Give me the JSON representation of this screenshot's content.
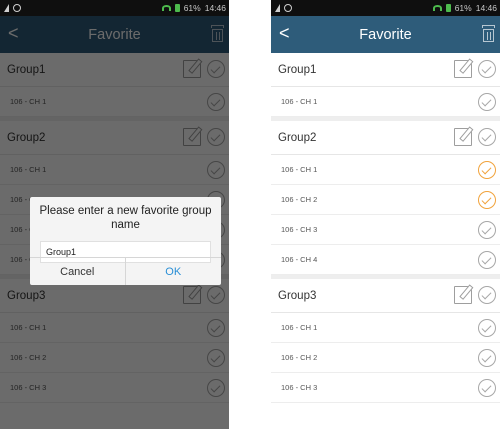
{
  "status_bar": {
    "battery": "61%",
    "time": "14:46"
  },
  "title_bar": {
    "back_label": "<",
    "title": "Favorite"
  },
  "groups": [
    {
      "name": "Group1",
      "channels": [
        "106 - CH 1"
      ]
    },
    {
      "name": "Group2",
      "channels": [
        "106 - CH 1",
        "106 - CH 2",
        "106 - CH 3",
        "106 - CH 4"
      ]
    },
    {
      "name": "Group3",
      "channels": [
        "106 - CH 1",
        "106 - CH 2",
        "106 - CH 3"
      ]
    }
  ],
  "selected_right": [
    "Group2 / 106 - CH 1",
    "Group2 / 106 - CH 2"
  ],
  "dialog": {
    "title": "Please enter a new favorite group name",
    "input_value": "Group1",
    "cancel_label": "Cancel",
    "ok_label": "OK"
  },
  "colors": {
    "title_bar": "#2e5c7a",
    "selected_check": "#f1a33c",
    "ok_text": "#2a8fd6"
  },
  "icons": {
    "back": "back-arrow-icon",
    "delete": "trash-icon",
    "edit": "edit-icon",
    "check": "check-circle-icon"
  }
}
